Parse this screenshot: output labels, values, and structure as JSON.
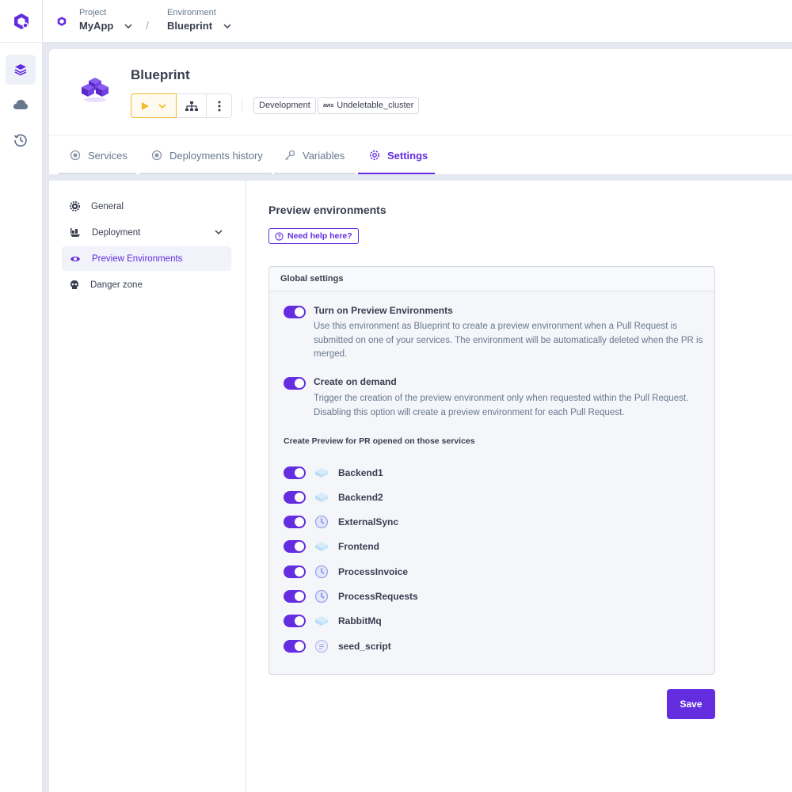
{
  "breadcrumb": {
    "project_label": "Project",
    "project_value": "MyApp",
    "environment_label": "Environment",
    "environment_value": "Blueprint"
  },
  "header": {
    "title": "Blueprint",
    "tags": [
      "Development",
      "Undeletable_cluster"
    ],
    "cloud_badge": "aws"
  },
  "tabs": [
    {
      "label": "Services",
      "icon": "circle-dot-icon"
    },
    {
      "label": "Deployments history",
      "icon": "circle-dot-icon"
    },
    {
      "label": "Variables",
      "icon": "key-icon"
    },
    {
      "label": "Settings",
      "icon": "gear-icon",
      "active": true
    }
  ],
  "sidenav": [
    {
      "label": "General",
      "icon": "gear-icon"
    },
    {
      "label": "Deployment",
      "icon": "ship-icon"
    },
    {
      "label": "Preview Environments",
      "icon": "eye-icon",
      "active": true
    },
    {
      "label": "Danger zone",
      "icon": "skull-icon"
    }
  ],
  "main": {
    "title": "Preview environments",
    "help_label": "Need help here?",
    "panel_title": "Global settings",
    "option1_title": "Turn on Preview Environments",
    "option1_desc": "Use this environment as Blueprint to create a preview environment when a Pull Request is submitted on one of your services. The environment will be automatically deleted when the PR is merged.",
    "option1_on": true,
    "option2_title": "Create on demand",
    "option2_desc": "Trigger the creation of the preview environment only when requested within the Pull Request. Disabling this option will create a preview environment for each Pull Request.",
    "option2_on": true,
    "services_heading": "Create Preview for PR opened on those services",
    "services": [
      {
        "name": "Backend1",
        "icon": "application-icon",
        "enabled": true
      },
      {
        "name": "Backend2",
        "icon": "application-icon",
        "enabled": true
      },
      {
        "name": "ExternalSync",
        "icon": "cronjob-icon",
        "enabled": true
      },
      {
        "name": "Frontend",
        "icon": "application-icon",
        "enabled": true
      },
      {
        "name": "ProcessInvoice",
        "icon": "cronjob-icon",
        "enabled": true
      },
      {
        "name": "ProcessRequests",
        "icon": "cronjob-icon",
        "enabled": true
      },
      {
        "name": "RabbitMq",
        "icon": "application-icon",
        "enabled": true
      },
      {
        "name": "seed_script",
        "icon": "lifecycle-job-icon",
        "enabled": true
      }
    ],
    "save_label": "Save"
  },
  "colors": {
    "accent": "#642de0",
    "play_accent": "#f4b931",
    "text": "#383e50",
    "muted": "#67778e"
  }
}
